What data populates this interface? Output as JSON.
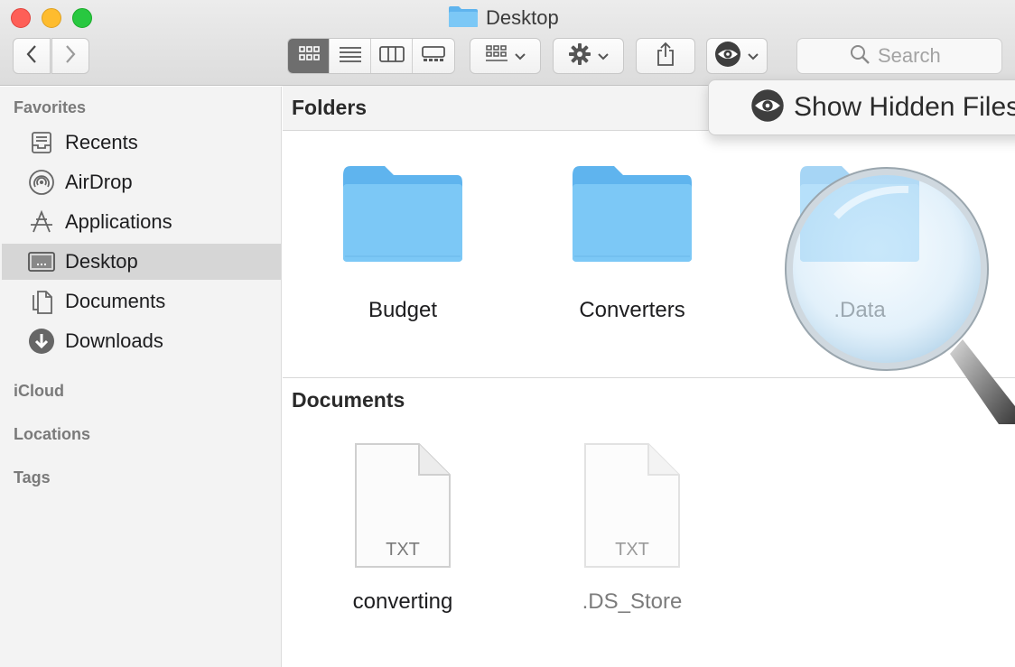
{
  "window": {
    "title": "Desktop"
  },
  "toolbar": {
    "back_icon": "chevron-left-icon",
    "forward_icon": "chevron-right-icon",
    "view_modes": [
      "icon-view",
      "list-view",
      "column-view",
      "gallery-view"
    ],
    "active_view": "icon-view",
    "group_icon": "group-grid-icon",
    "action_icon": "gear-icon",
    "share_icon": "share-icon",
    "hidden_files_icon": "eye-icon",
    "search": {
      "placeholder": "Search"
    }
  },
  "popup": {
    "label": "Show Hidden Files",
    "icon": "eye-icon"
  },
  "sidebar": {
    "favorites_heading": "Favorites",
    "items": [
      {
        "label": "Recents",
        "icon": "recents-icon"
      },
      {
        "label": "AirDrop",
        "icon": "airdrop-icon"
      },
      {
        "label": "Applications",
        "icon": "applications-icon"
      },
      {
        "label": "Desktop",
        "icon": "desktop-icon",
        "selected": true
      },
      {
        "label": "Documents",
        "icon": "document-icon"
      },
      {
        "label": "Downloads",
        "icon": "download-icon"
      }
    ],
    "icloud_heading": "iCloud",
    "locations_heading": "Locations",
    "tags_heading": "Tags"
  },
  "main": {
    "folders_heading": "Folders",
    "folders": [
      {
        "name": "Budget",
        "hidden": false
      },
      {
        "name": "Converters",
        "hidden": false
      },
      {
        "name": ".Data",
        "hidden": true
      }
    ],
    "documents_heading": "Documents",
    "documents": [
      {
        "name": "converting",
        "type": "TXT",
        "hidden": false
      },
      {
        "name": ".DS_Store",
        "type": "TXT",
        "hidden": true
      }
    ]
  },
  "colors": {
    "folder": "#7cc8f6",
    "selected_sidebar": "#d6d6d6",
    "close": "#fe5f57",
    "minimize": "#febc2e",
    "zoom": "#28c840"
  }
}
